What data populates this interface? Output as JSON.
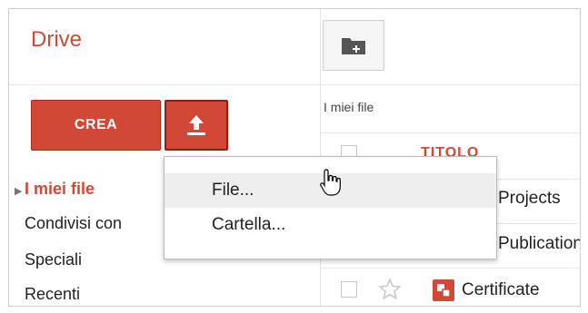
{
  "app": {
    "title": "Drive"
  },
  "toolbar": {
    "create_label": "CREA"
  },
  "nav": {
    "items": [
      {
        "label": "I miei file",
        "active": true
      },
      {
        "label": "Condivisi con"
      },
      {
        "label": "Speciali"
      },
      {
        "label": "Recenti"
      }
    ]
  },
  "menu": {
    "items": [
      {
        "label": "File..."
      },
      {
        "label": "Cartella..."
      }
    ]
  },
  "main": {
    "section_label": "I miei file",
    "column_title": "TITOLO",
    "rows": [
      {
        "name": "Projects"
      },
      {
        "name": "Publications"
      },
      {
        "name": "Certificate"
      }
    ]
  },
  "icons": {
    "upload": "upload-icon",
    "new_folder": "new-folder-icon",
    "star": "star-icon",
    "cursor": "hand-cursor-icon",
    "file": "document-icon"
  },
  "colors": {
    "accent": "#d14836"
  }
}
